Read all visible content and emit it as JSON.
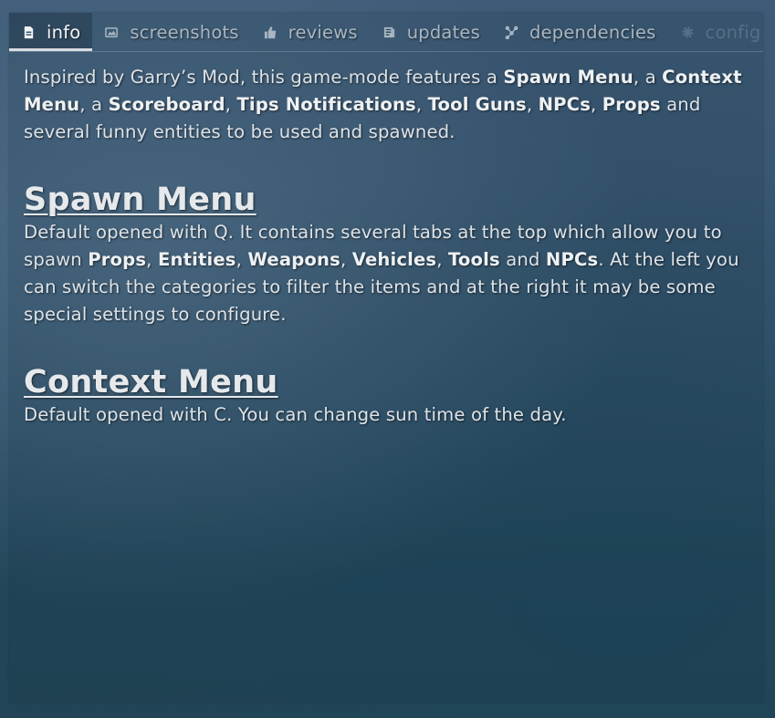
{
  "tabs": [
    {
      "label": "info",
      "icon": "document-icon",
      "active": true
    },
    {
      "label": "screenshots",
      "icon": "image-icon",
      "active": false
    },
    {
      "label": "reviews",
      "icon": "review-icon",
      "active": false
    },
    {
      "label": "updates",
      "icon": "updates-icon",
      "active": false
    },
    {
      "label": "dependencies",
      "icon": "dependencies-icon",
      "active": false
    },
    {
      "label": "config",
      "icon": "gear-icon",
      "active": false
    }
  ],
  "intro": {
    "t1": "Inspired by Garry’s Mod, this game-mode features a ",
    "b1": "Spawn Menu",
    "t2": ", a ",
    "b2": "Context Menu",
    "t3": ", a ",
    "b3": "Scoreboard",
    "t4": ", ",
    "b4": "Tips Notifications",
    "t5": ", ",
    "b5": "Tool Guns",
    "t6": ", ",
    "b6": "NPCs",
    "t7": ", ",
    "b7": "Props",
    "t8": " and several funny entities to be used and spawned."
  },
  "spawn_menu": {
    "heading": "Spawn Menu",
    "t1": "Default opened with Q. It contains several tabs at the top which allow you to spawn ",
    "b1": "Props",
    "t2": ", ",
    "b2": "Entities",
    "t3": ", ",
    "b3": "Weapons",
    "t4": ", ",
    "b4": "Vehicles",
    "t5": ", ",
    "b5": "Tools",
    "t6": " and ",
    "b6": "NPCs",
    "t7": ". At the left you can switch the categories to filter the items and at the right it may be some special settings to configure."
  },
  "context_menu": {
    "heading": "Context Menu",
    "text": "Default opened with C. You can change sun time of the day."
  }
}
